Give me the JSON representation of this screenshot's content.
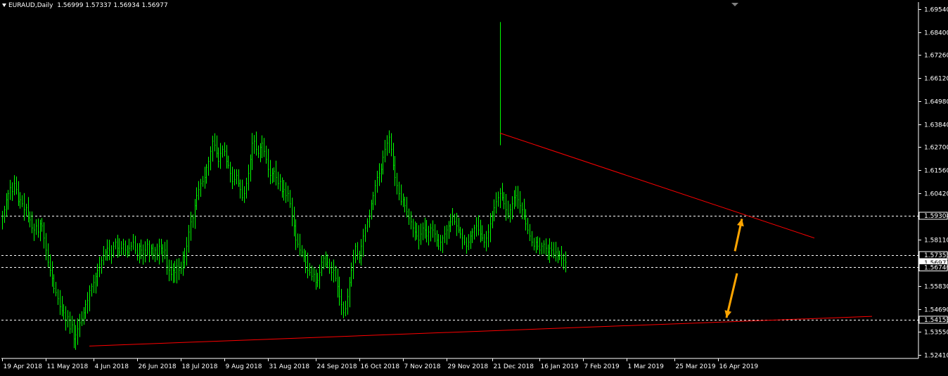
{
  "header": {
    "symbol": "EURAUD,Daily",
    "ohlc": "1.56999 1.57337 1.56934 1.56977"
  },
  "colors": {
    "background": "#000000",
    "candle": "#00ff00",
    "trendline": "#ff0000",
    "arrow": "#ffa500",
    "level_line": "#ffffff",
    "axis_text": "#ffffff"
  },
  "chart_data": {
    "type": "candlestick",
    "title": "EURAUD,Daily",
    "y_ticks": [
      "1.69540",
      "1.68400",
      "1.67260",
      "1.66120",
      "1.64980",
      "1.63840",
      "1.62700",
      "1.61560",
      "1.60420",
      "1.58110",
      "1.55830",
      "1.54690",
      "1.53550",
      "1.52410"
    ],
    "ylim": [
      1.5241,
      1.6954
    ],
    "x_ticks": [
      "19 Apr 2018",
      "11 May 2018",
      "4 Jun 2018",
      "26 Jun 2018",
      "18 Jul 2018",
      "9 Aug 2018",
      "31 Aug 2018",
      "24 Sep 2018",
      "16 Oct 2018",
      "7 Nov 2018",
      "29 Nov 2018",
      "21 Dec 2018",
      "16 Jan 2019",
      "7 Feb 2019",
      "1 Mar 2019",
      "25 Mar 2019",
      "16 Apr 2019"
    ],
    "price_labels": [
      {
        "text": "1.59304",
        "value": 1.59304,
        "style": "plain"
      },
      {
        "text": "1.57355",
        "value": 1.57355,
        "style": "plain"
      },
      {
        "text": "1.56977",
        "value": 1.56977,
        "style": "current"
      },
      {
        "text": "1.56746",
        "value": 1.56746,
        "style": "plain"
      },
      {
        "text": "1.54153",
        "value": 1.54153,
        "style": "plain"
      }
    ],
    "horizontal_levels": [
      1.59304,
      1.57355,
      1.56746,
      1.54153
    ],
    "trendlines": [
      {
        "name": "resistance",
        "from": {
          "x": "21 Dec 2018",
          "y": 1.634
        },
        "to": {
          "x": "4 May 2019",
          "y": 1.582
        }
      },
      {
        "name": "support",
        "from": {
          "x": "4 Jun 2018",
          "y": 1.5285
        },
        "to": {
          "x": "4 May 2019",
          "y": 1.5432
        }
      }
    ],
    "arrows": [
      {
        "name": "arrow-up-to-resistance",
        "from": {
          "x": "16 Apr 2019",
          "y": 1.5755
        },
        "to": {
          "x": "18 Apr 2019",
          "y": 1.5915
        }
      },
      {
        "name": "arrow-down-to-support",
        "from": {
          "x": "18 Apr 2019",
          "y": 1.5645
        },
        "to": {
          "x": "14 Apr 2019",
          "y": 1.5425
        }
      }
    ],
    "closes": [
      1.592,
      1.596,
      1.601,
      1.604,
      1.607,
      1.605,
      1.609,
      1.606,
      1.6,
      1.601,
      1.599,
      1.596,
      1.597,
      1.592,
      1.591,
      1.587,
      1.586,
      1.588,
      1.585,
      1.589,
      1.588,
      1.582,
      1.576,
      1.57,
      1.566,
      1.562,
      1.557,
      1.555,
      1.552,
      1.548,
      1.546,
      1.545,
      1.541,
      1.543,
      1.537,
      1.539,
      1.532,
      1.534,
      1.537,
      1.54,
      1.542,
      1.545,
      1.549,
      1.551,
      1.556,
      1.558,
      1.56,
      1.563,
      1.566,
      1.569,
      1.571,
      1.573,
      1.575,
      1.577,
      1.576,
      1.574,
      1.578,
      1.58,
      1.577,
      1.575,
      1.577,
      1.579,
      1.576,
      1.575,
      1.577,
      1.578,
      1.58,
      1.576,
      1.574,
      1.578,
      1.576,
      1.574,
      1.576,
      1.579,
      1.575,
      1.577,
      1.574,
      1.576,
      1.574,
      1.578,
      1.577,
      1.575,
      1.576,
      1.568,
      1.566,
      1.564,
      1.566,
      1.565,
      1.568,
      1.566,
      1.567,
      1.57,
      1.573,
      1.578,
      1.585,
      1.59,
      1.592,
      1.598,
      1.603,
      1.606,
      1.609,
      1.61,
      1.612,
      1.617,
      1.62,
      1.625,
      1.63,
      1.628,
      1.624,
      1.62,
      1.624,
      1.626,
      1.625,
      1.62,
      1.618,
      1.614,
      1.61,
      1.611,
      1.613,
      1.609,
      1.606,
      1.602,
      1.604,
      1.609,
      1.614,
      1.621,
      1.629,
      1.63,
      1.626,
      1.624,
      1.627,
      1.629,
      1.625,
      1.621,
      1.616,
      1.613,
      1.614,
      1.615,
      1.612,
      1.609,
      1.61,
      1.605,
      1.606,
      1.603,
      1.604,
      1.599,
      1.593,
      1.588,
      1.581,
      1.579,
      1.576,
      1.575,
      1.573,
      1.57,
      1.566,
      1.565,
      1.563,
      1.564,
      1.56,
      1.561,
      1.565,
      1.57,
      1.572,
      1.569,
      1.57,
      1.567,
      1.565,
      1.566,
      1.562,
      1.558,
      1.553,
      1.549,
      1.545,
      1.547,
      1.553,
      1.56,
      1.566,
      1.572,
      1.578,
      1.574,
      1.572,
      1.578,
      1.583,
      1.587,
      1.59,
      1.594,
      1.599,
      1.603,
      1.608,
      1.612,
      1.614,
      1.616,
      1.622,
      1.626,
      1.629,
      1.632,
      1.626,
      1.618,
      1.612,
      1.608,
      1.604,
      1.6,
      1.601,
      1.598,
      1.595,
      1.592,
      1.59,
      1.587,
      1.585,
      1.583,
      1.581,
      1.584,
      1.587,
      1.586,
      1.583,
      1.585,
      1.587,
      1.586,
      1.584,
      1.581,
      1.578,
      1.58,
      1.582,
      1.584,
      1.586,
      1.588,
      1.59,
      1.592,
      1.59,
      1.588,
      1.586,
      1.584,
      1.582,
      1.58,
      1.578,
      1.58,
      1.583,
      1.585,
      1.587,
      1.588,
      1.586,
      1.584,
      1.582,
      1.58,
      1.582,
      1.585,
      1.589,
      1.593,
      1.597,
      1.6,
      1.602,
      1.604,
      1.602,
      1.599,
      1.596,
      1.594,
      1.596,
      1.599,
      1.602,
      1.603,
      1.601,
      1.598,
      1.596,
      1.593,
      1.589,
      1.586,
      1.583,
      1.58,
      1.578,
      1.58,
      1.578,
      1.576,
      1.578,
      1.579,
      1.577,
      1.575,
      1.577,
      1.576,
      1.574,
      1.575,
      1.573,
      1.574,
      1.572,
      1.571,
      1.57
    ]
  }
}
